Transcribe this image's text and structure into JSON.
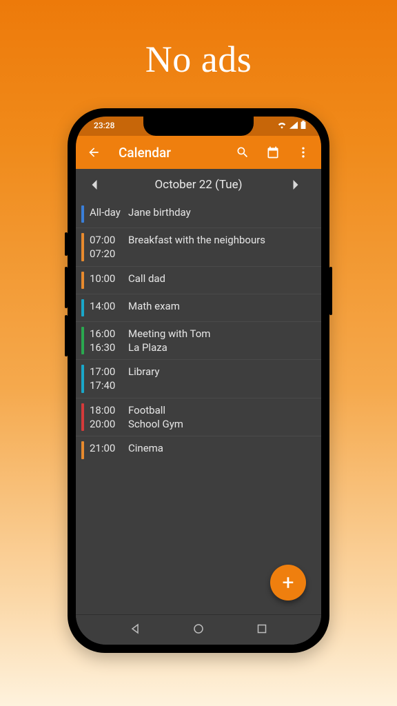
{
  "promo": {
    "headline": "No ads"
  },
  "status": {
    "time": "23:28"
  },
  "appbar": {
    "title": "Calendar"
  },
  "datenav": {
    "label": "October 22 (Tue)"
  },
  "events": [
    {
      "color": "#3a7fd9",
      "time1": "All-day",
      "time2": "",
      "title1": "Jane birthday",
      "title2": ""
    },
    {
      "color": "#e78a2e",
      "time1": "07:00",
      "time2": "07:20",
      "title1": "Breakfast with the neighbours",
      "title2": ""
    },
    {
      "color": "#e78a2e",
      "time1": "10:00",
      "time2": "",
      "title1": "Call dad",
      "title2": ""
    },
    {
      "color": "#1aa7c9",
      "time1": "14:00",
      "time2": "",
      "title1": "Math exam",
      "title2": ""
    },
    {
      "color": "#2aa84f",
      "time1": "16:00",
      "time2": "16:30",
      "title1": "Meeting with Tom",
      "title2": "La Plaza"
    },
    {
      "color": "#1aa7c9",
      "time1": "17:00",
      "time2": "17:40",
      "title1": "Library",
      "title2": ""
    },
    {
      "color": "#d43a3a",
      "time1": "18:00",
      "time2": "20:00",
      "title1": "Football",
      "title2": "School Gym"
    },
    {
      "color": "#e78a2e",
      "time1": "21:00",
      "time2": "",
      "title1": "Cinema",
      "title2": ""
    }
  ],
  "fab": {
    "label": "+"
  }
}
